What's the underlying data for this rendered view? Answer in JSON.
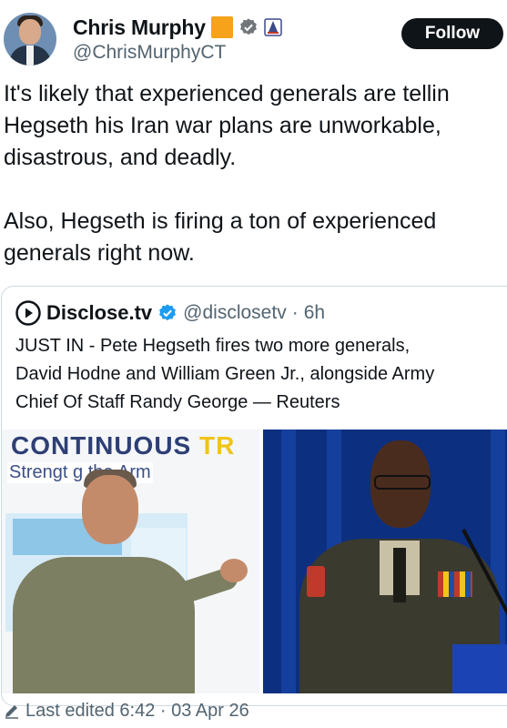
{
  "author": {
    "display_name": "Chris Murphy",
    "handle": "@ChrisMurphyCT"
  },
  "follow_label": "Follow",
  "tweet": {
    "text": "It's likely that experienced generals are tellin\nHegseth his Iran war plans are unworkable,\ndisastrous, and deadly.\n\nAlso, Hegseth is firing a ton of experienced\ngenerals right now."
  },
  "quote": {
    "display_name": "Disclose.tv",
    "handle": "@disclosetv",
    "separator": "·",
    "age": "6h",
    "text": "JUST IN - Pete Hegseth fires two more generals,\nDavid Hodne and William Green Jr., alongside Army\nChief Of Staff Randy George — Reuters",
    "photo_left": {
      "banner_a": "CONTINUOUS ",
      "banner_b": "TR",
      "subline": "Strengt      g the Arm"
    }
  },
  "footer": {
    "edited_label": "Last edited 6:42 · 03 Apr 26"
  },
  "icons": [
    "orange-square-icon",
    "verified-badge-icon",
    "flag-icon",
    "disclose-logo-icon",
    "pencil-icon"
  ],
  "colors": {
    "text": "#0f1419",
    "muted": "#536471",
    "verified_blue": "#1d9bf0",
    "follow_bg": "#0f1419",
    "accent_orange": "#f6a21a"
  }
}
